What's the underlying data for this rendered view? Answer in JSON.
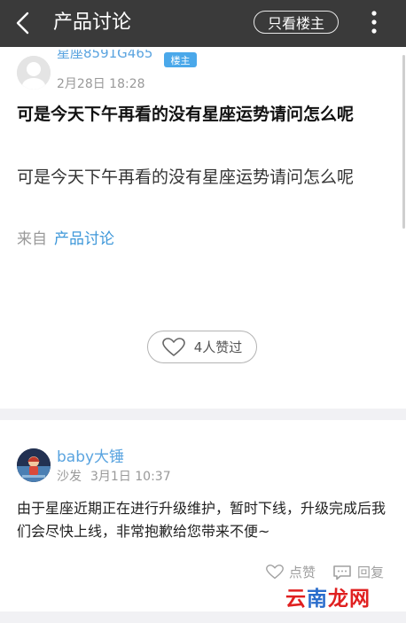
{
  "topbar": {
    "title": "产品讨论",
    "only_host_label": "只看楼主"
  },
  "post": {
    "author": "星座8591G465",
    "host_badge": "楼主",
    "date": "2月28日 18:28",
    "title": "可是今天下午再看的没有星座运势请问怎么呢",
    "body": "可是今天下午再看的没有星座运势请问怎么呢",
    "from_label": "来自",
    "from_link": "产品讨论",
    "likes_label": "4人赞过"
  },
  "comment": {
    "author": "baby大锤",
    "floor": "沙发",
    "time": "3月1日 10:37",
    "body": "由于星座近期正在进行升级维护，暂时下线，升级完成后我们会尽快上线，非常抱歉给您带来不便~",
    "like_label": "点赞",
    "reply_label": "回复"
  },
  "watermark": {
    "part1": "云",
    "part2": "南",
    "part3": "龙网"
  },
  "colors": {
    "topbar": "#3a3a3a",
    "link": "#3d97d9",
    "badge": "#4aa8ea"
  }
}
